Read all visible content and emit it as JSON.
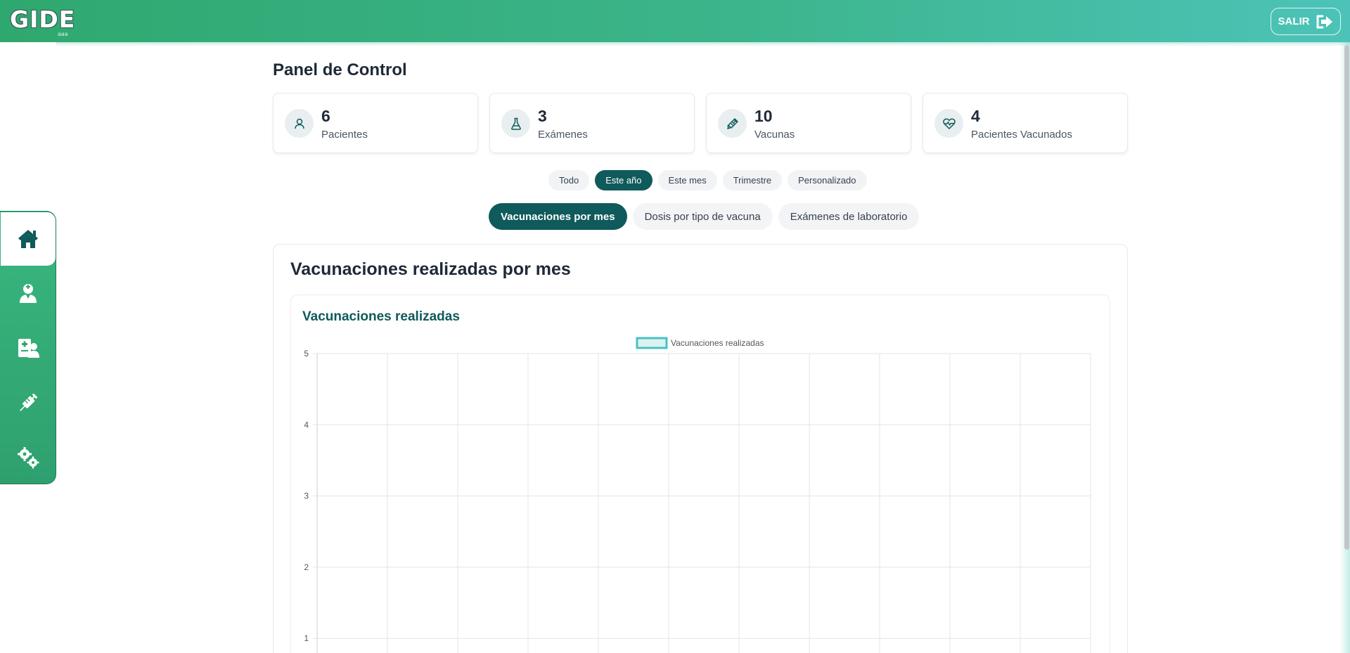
{
  "app": {
    "logo_text": "GIDE",
    "logo_sub": "aaa",
    "logout_label": "SALIR"
  },
  "sidebar": {
    "items": [
      {
        "name": "home",
        "icon": "home-icon",
        "active": true
      },
      {
        "name": "patients",
        "icon": "user-doctor-icon",
        "active": false
      },
      {
        "name": "records",
        "icon": "medical-record-icon",
        "active": false
      },
      {
        "name": "vaccines",
        "icon": "syringe-icon",
        "active": false
      },
      {
        "name": "settings",
        "icon": "gears-icon",
        "active": false
      }
    ]
  },
  "main": {
    "title": "Panel de Control",
    "stats": [
      {
        "value": "6",
        "label": "Pacientes",
        "icon": "user-icon"
      },
      {
        "value": "3",
        "label": "Exámenes",
        "icon": "flask-icon"
      },
      {
        "value": "10",
        "label": "Vacunas",
        "icon": "syringe-icon"
      },
      {
        "value": "4",
        "label": "Pacientes Vacunados",
        "icon": "heart-pulse-icon"
      }
    ],
    "filters": [
      "Todo",
      "Este año",
      "Este mes",
      "Trimestre",
      "Personalizado"
    ],
    "active_filter": "Este año",
    "tabs": [
      "Vacunaciones por mes",
      "Dosis por tipo de vacuna",
      "Exámenes de laboratorio"
    ],
    "active_tab": "Vacunaciones por mes",
    "chart_section_title": "Vacunaciones realizadas por mes",
    "chart_card_title": "Vacunaciones realizadas"
  },
  "colors": {
    "brand_dark": "#0f5a5a",
    "topbar_start": "#2fa86f",
    "topbar_end": "#4cc3b8",
    "legend_stroke": "#4bc0c0"
  },
  "chart_data": {
    "type": "bar",
    "legend": [
      "Vacunaciones realizadas"
    ],
    "legend_position": "top-center",
    "series": [
      {
        "name": "Vacunaciones realizadas",
        "values": []
      }
    ],
    "yticks": [
      "5",
      "4",
      "3",
      "2",
      "1"
    ],
    "grid": true,
    "visible_ylim": [
      1,
      5
    ]
  }
}
